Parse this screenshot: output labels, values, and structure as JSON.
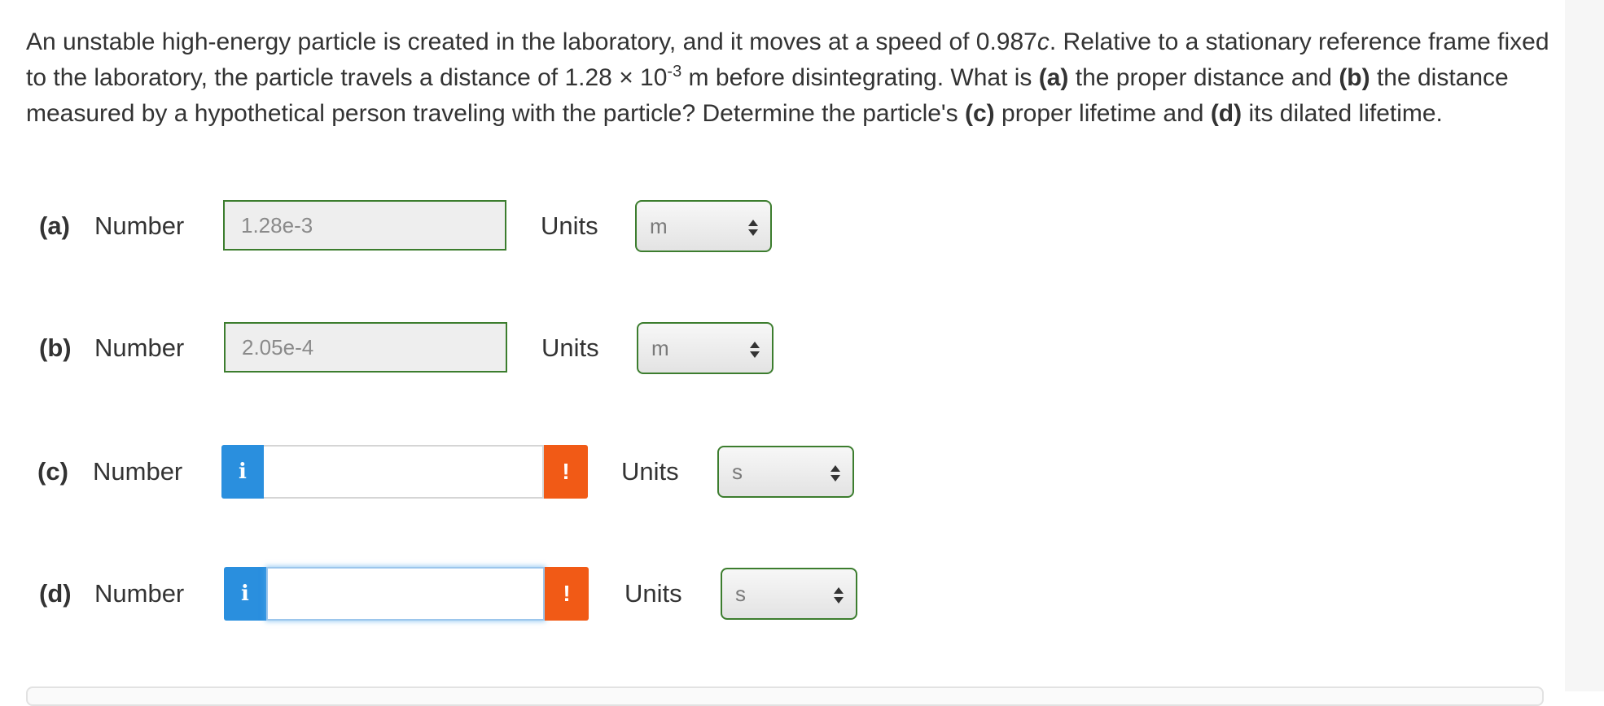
{
  "question": {
    "part1": "An unstable high-energy particle is created in the laboratory, and it moves at a speed of 0.987",
    "speed_symbol": "c",
    "part2": ". Relative to a stationary reference frame fixed to the laboratory, the particle travels a distance of 1.28 × 10",
    "exponent": "-3",
    "part3": " m before disintegrating. What is ",
    "label_a": "(a)",
    "part4": " the proper distance and ",
    "label_b": "(b)",
    "part5": " the distance measured by a hypothetical person traveling with the particle? Determine the particle's ",
    "label_c": "(c)",
    "part6": " proper lifetime and ",
    "label_d": "(d)",
    "part7": " its dilated lifetime."
  },
  "rows": {
    "a": {
      "part": "(a)",
      "number_label": "Number",
      "value": "1.28e-3",
      "units_label": "Units",
      "unit": "m"
    },
    "b": {
      "part": "(b)",
      "number_label": "Number",
      "value": "2.05e-4",
      "units_label": "Units",
      "unit": "m"
    },
    "c": {
      "part": "(c)",
      "number_label": "Number",
      "info_icon": "i",
      "warn_icon": "!",
      "value": "",
      "units_label": "Units",
      "unit": "s"
    },
    "d": {
      "part": "(d)",
      "number_label": "Number",
      "info_icon": "i",
      "warn_icon": "!",
      "value": "",
      "units_label": "Units",
      "unit": "s"
    }
  },
  "colors": {
    "answered_border": "#3c7d2e",
    "info_button": "#2a8fde",
    "warning_button": "#f15a16"
  }
}
